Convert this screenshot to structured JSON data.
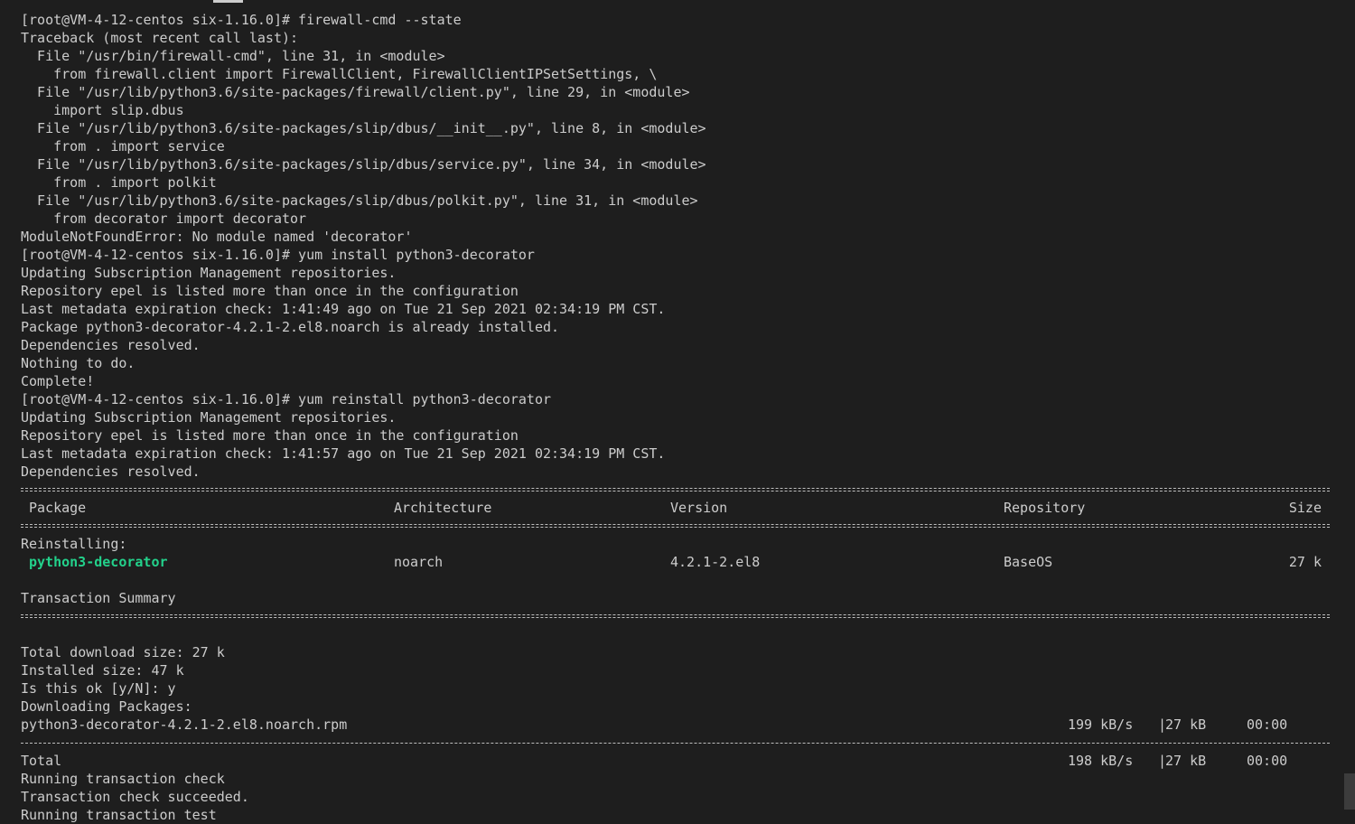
{
  "terminal": {
    "lines_top": [
      "[root@VM-4-12-centos six-1.16.0]# firewall-cmd --state",
      "Traceback (most recent call last):",
      "  File \"/usr/bin/firewall-cmd\", line 31, in <module>",
      "    from firewall.client import FirewallClient, FirewallClientIPSetSettings, \\",
      "  File \"/usr/lib/python3.6/site-packages/firewall/client.py\", line 29, in <module>",
      "    import slip.dbus",
      "  File \"/usr/lib/python3.6/site-packages/slip/dbus/__init__.py\", line 8, in <module>",
      "    from . import service",
      "  File \"/usr/lib/python3.6/site-packages/slip/dbus/service.py\", line 34, in <module>",
      "    from . import polkit",
      "  File \"/usr/lib/python3.6/site-packages/slip/dbus/polkit.py\", line 31, in <module>",
      "    from decorator import decorator",
      "ModuleNotFoundError: No module named 'decorator'",
      "[root@VM-4-12-centos six-1.16.0]# yum install python3-decorator",
      "Updating Subscription Management repositories.",
      "Repository epel is listed more than once in the configuration",
      "Last metadata expiration check: 1:41:49 ago on Tue 21 Sep 2021 02:34:19 PM CST.",
      "Package python3-decorator-4.2.1-2.el8.noarch is already installed.",
      "Dependencies resolved.",
      "Nothing to do.",
      "Complete!",
      "[root@VM-4-12-centos six-1.16.0]# yum reinstall python3-decorator",
      "Updating Subscription Management repositories.",
      "Repository epel is listed more than once in the configuration",
      "Last metadata expiration check: 1:41:57 ago on Tue 21 Sep 2021 02:34:19 PM CST.",
      "Dependencies resolved."
    ],
    "table": {
      "headers": {
        "package": "Package",
        "architecture": "Architecture",
        "version": "Version",
        "repository": "Repository",
        "size": "Size"
      },
      "section_label": "Reinstalling:",
      "row": {
        "package": "python3-decorator",
        "architecture": "noarch",
        "version": "4.2.1-2.el8",
        "repository": "BaseOS",
        "size": "27 k"
      },
      "summary_label": "Transaction Summary"
    },
    "lines_after_summary": [
      "Total download size: 27 k",
      "Installed size: 47 k",
      "Is this ok [y/N]: y",
      "Downloading Packages:"
    ],
    "download": {
      "file": "python3-decorator-4.2.1-2.el8.noarch.rpm",
      "rate": "199 kB/s",
      "bar": "|",
      "size": "27 kB",
      "time": "00:00"
    },
    "total": {
      "label": "Total",
      "rate": "198 kB/s",
      "bar": "|",
      "size": "27 kB",
      "time": "00:00"
    },
    "lines_bottom": [
      "Running transaction check",
      "Transaction check succeeded.",
      "Running transaction test"
    ],
    "colors": {
      "background": "#1e1e1e",
      "text": "#cccccc",
      "highlight": "#23d18b"
    }
  }
}
